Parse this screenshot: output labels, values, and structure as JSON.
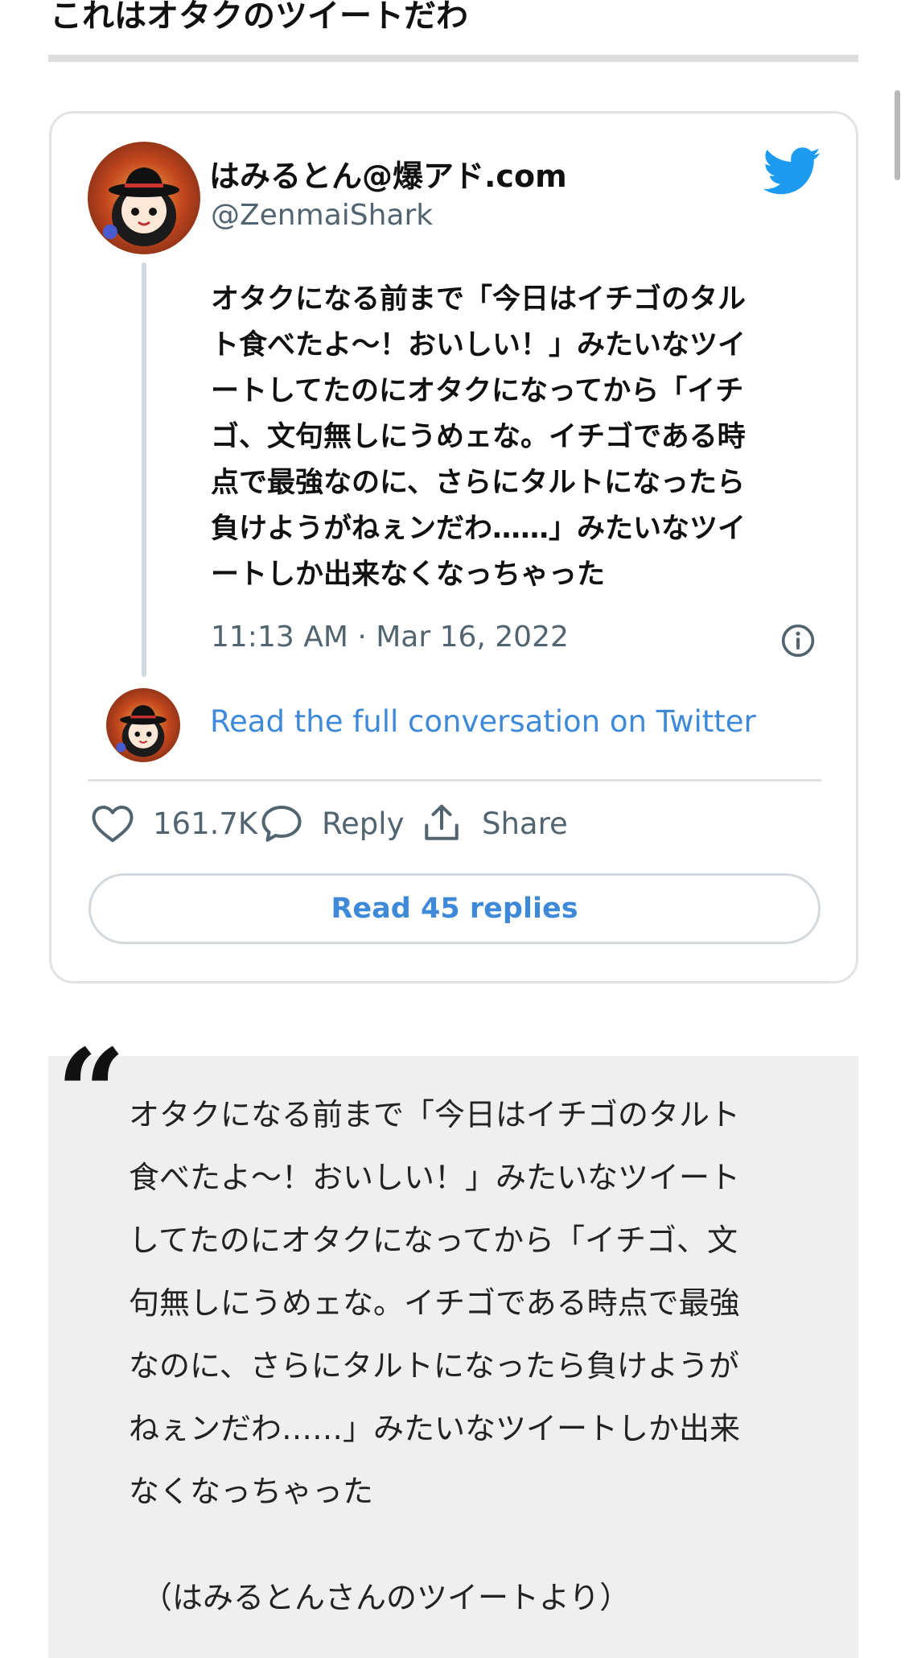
{
  "page": {
    "heading": "これはオタクのツイートだわ"
  },
  "tweet": {
    "display_name": "はみるとん@爆アド.com",
    "handle": "@ZenmaiShark",
    "text_lines": [
      "オタクになる前まで「今日はイチゴのタル",
      "ト食べたよ～！おいしい！」みたいなツイ",
      "ートしてたのにオタクになってから「イチ",
      "ゴ、文句無しにうめェな。イチゴである時",
      "点で最強なのに、さらにタルトになったら",
      "負けようがねぇンだわ……」みたいなツイ",
      "ートしか出来なくなっちゃった"
    ],
    "timestamp": "11:13 AM · Mar 16, 2022",
    "read_conversation": "Read the full conversation on Twitter",
    "like_count": "161.7K",
    "reply_label": "Reply",
    "share_label": "Share",
    "read_replies": "Read 45 replies",
    "accent_color": "#1d9bf0",
    "link_color": "#3f8ad8"
  },
  "icons": {
    "brand": "twitter-bird-icon",
    "info": "info-icon",
    "like": "heart-icon",
    "reply": "speech-bubble-icon",
    "share": "share-upload-icon"
  },
  "quote": {
    "mark": "“",
    "lines": [
      "オタクになる前まで「今日はイチゴのタルト",
      "食べたよ～！おいしい！」みたいなツイート",
      "してたのにオタクになってから「イチゴ、文",
      "句無しにうめェな。イチゴである時点で最強",
      "なのに、さらにタルトになったら負けようが",
      "ねぇンだわ……」みたいなツイートしか出来",
      "なくなっちゃった"
    ],
    "source": "（はみるとんさんのツイートより）"
  }
}
